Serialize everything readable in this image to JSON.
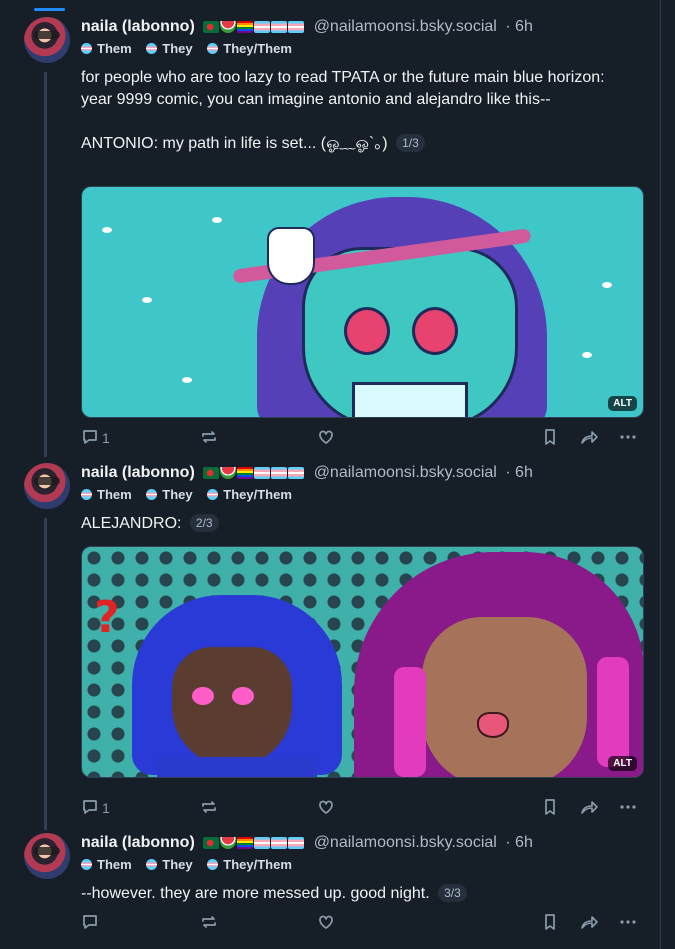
{
  "author": {
    "name": "naila (labonno)",
    "handle": "@nailamoonsi.bsky.social",
    "pronouns": [
      "Them",
      "They",
      "They/Them"
    ],
    "flags": [
      "bangladesh-flag-icon",
      "watermelon-icon",
      "pride-flag-icon",
      "trans-flag-icon",
      "trans-flag-icon",
      "trans-flag-icon"
    ]
  },
  "posts": [
    {
      "time": "· 6h",
      "text": "for people who are too lazy to read TPATA or the future main blue horizon: year 9999 comic, you can imagine antonio and alejandro like this--\n\nANTONIO: my path in life is set... (ஓ﹏ஓ`。)",
      "badge": "1/3",
      "image_alt_label": "ALT",
      "replies": "1"
    },
    {
      "time": "· 6h",
      "text": "ALEJANDRO:",
      "badge": "2/3",
      "image_alt_label": "ALT",
      "replies": "1"
    },
    {
      "time": "· 6h",
      "text": "--however. they are more messed up. good night.",
      "badge": "3/3",
      "replies": ""
    }
  ],
  "colors": {
    "background": "#161e27",
    "accent": "#208bfe",
    "text": "#f1f3f5",
    "muted": "#aebbc9",
    "thread_line": "#2e4052"
  }
}
